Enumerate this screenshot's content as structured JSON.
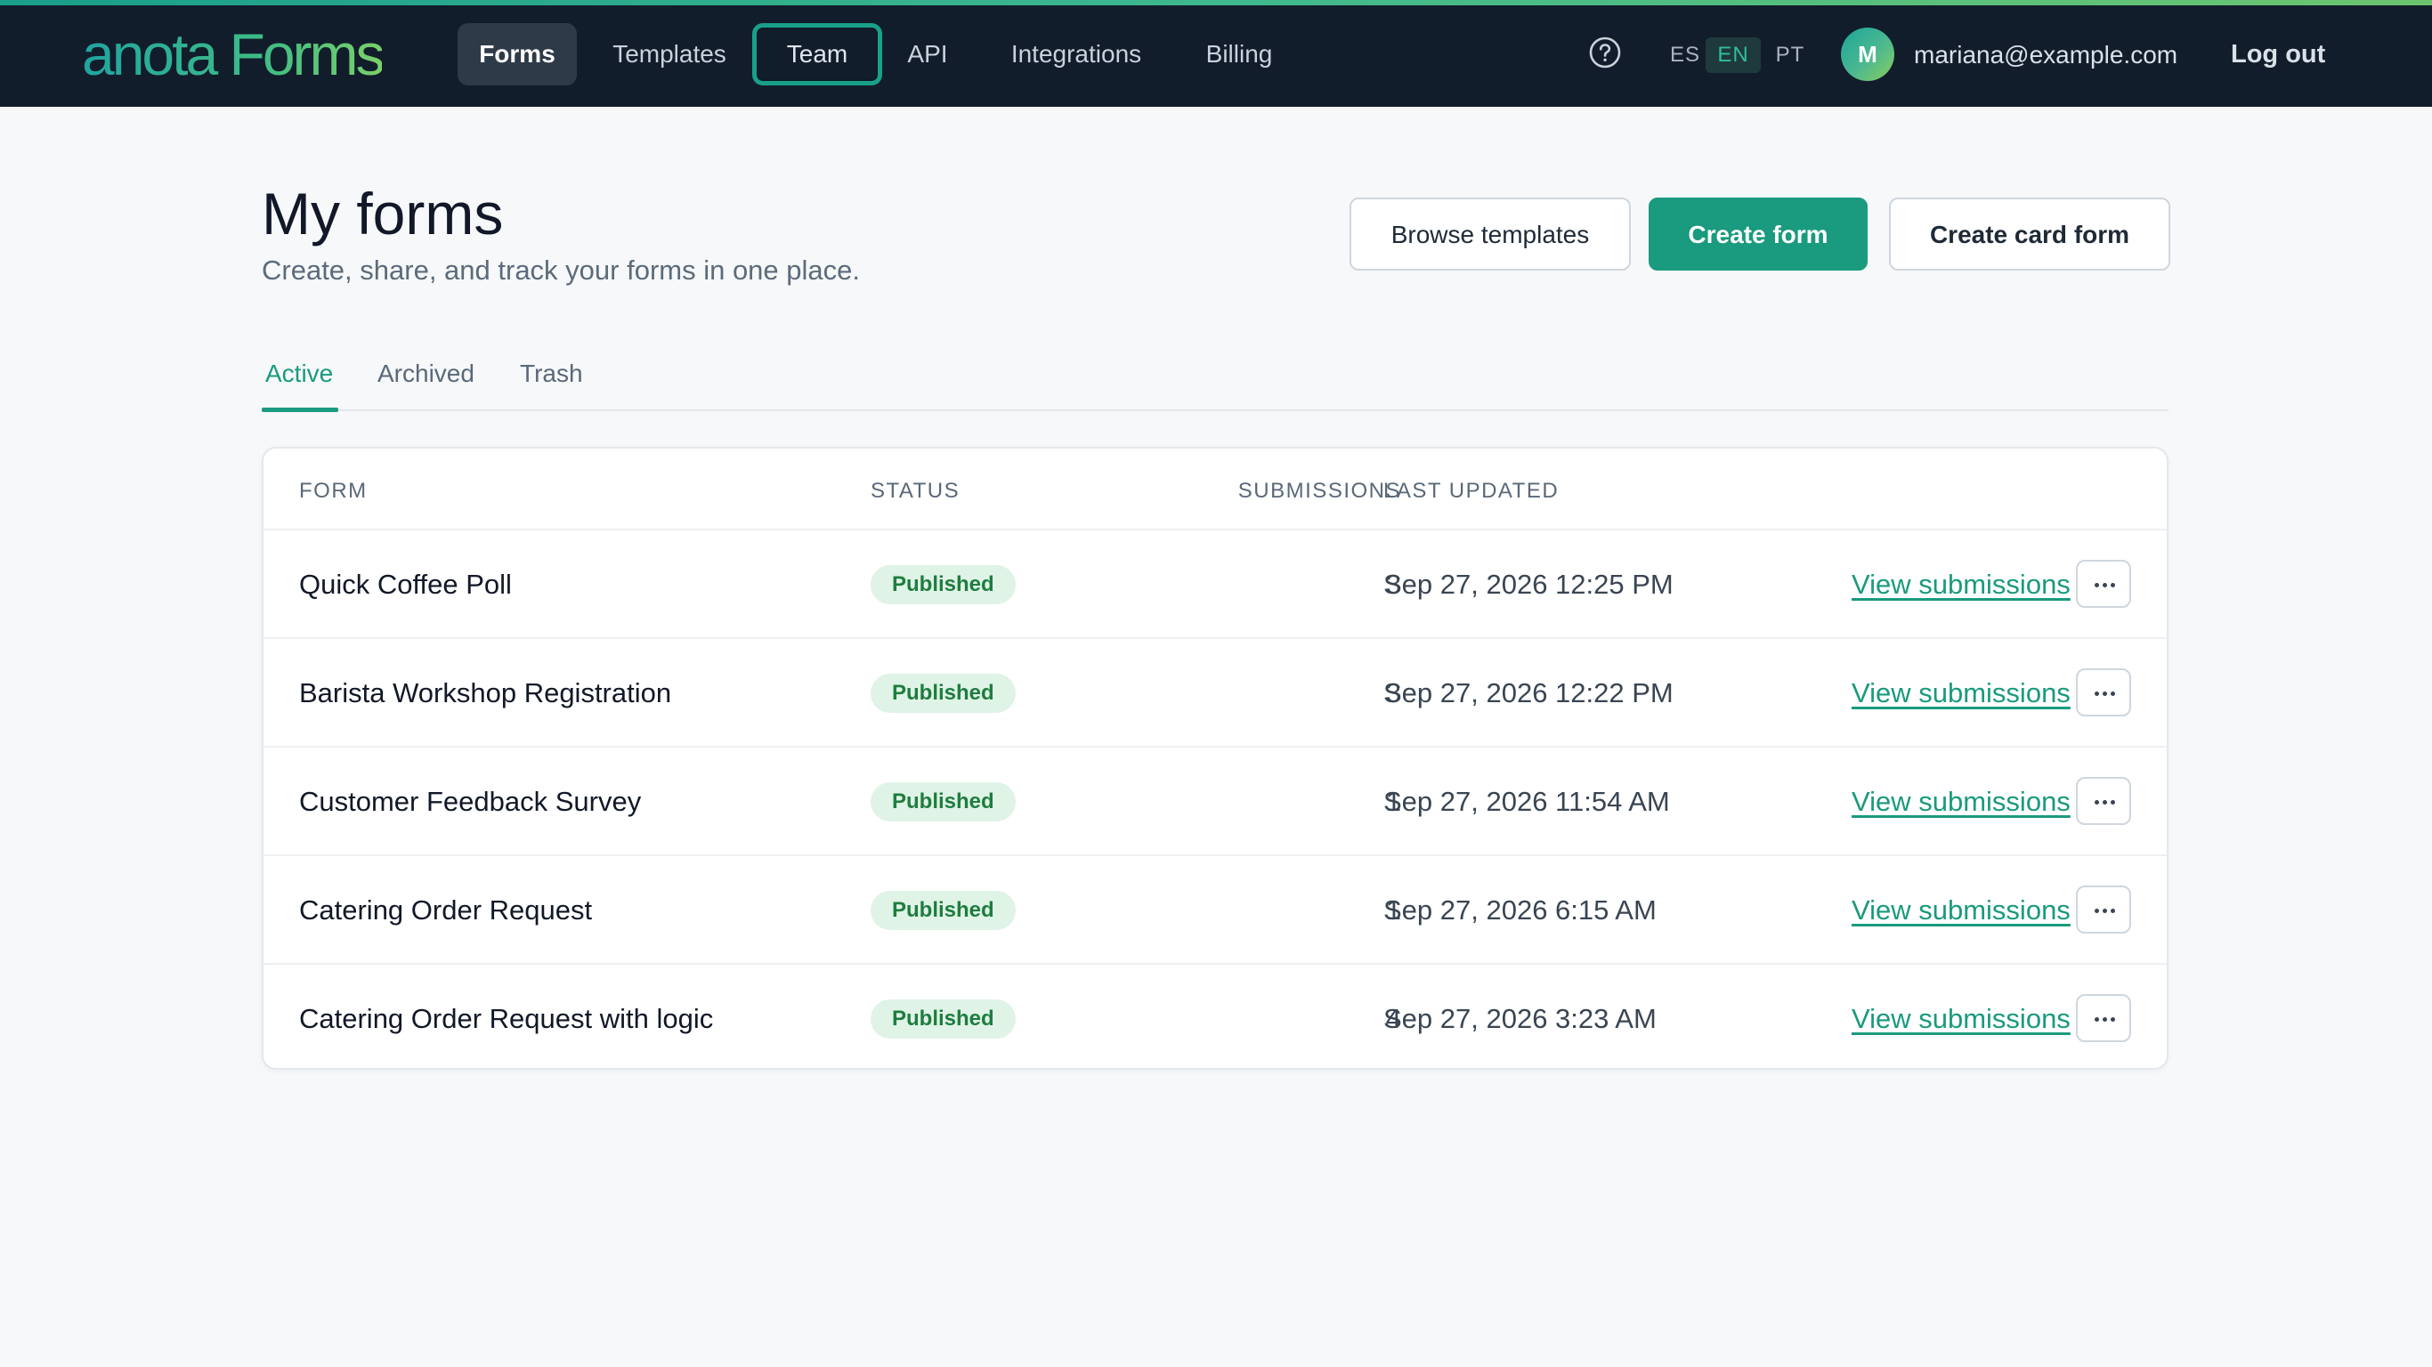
{
  "brand": {
    "logo": "anota Forms"
  },
  "nav": {
    "items": [
      {
        "label": "Forms"
      },
      {
        "label": "Templates"
      },
      {
        "label": "Team"
      },
      {
        "label": "API"
      },
      {
        "label": "Integrations"
      },
      {
        "label": "Billing"
      }
    ],
    "active": "Forms",
    "focused": "Team",
    "languages": [
      "ES",
      "EN",
      "PT"
    ],
    "active_language": "EN",
    "help_icon": "help-circle-icon",
    "user": {
      "avatar_initial": "M",
      "email": "mariana@example.com"
    },
    "logout_label": "Log out"
  },
  "header": {
    "title": "My forms",
    "subtitle": "Create, share, and track your forms in one place.",
    "actions": {
      "browse_templates": "Browse templates",
      "create_form": "Create form",
      "create_card_form": "Create card form"
    }
  },
  "tabs": [
    {
      "label": "Active"
    },
    {
      "label": "Archived"
    },
    {
      "label": "Trash"
    }
  ],
  "active_tab": "Active",
  "table": {
    "columns": {
      "form": "FORM",
      "status": "STATUS",
      "submissions": "SUBMISSIONS",
      "last_updated": "LAST UPDATED"
    },
    "rows": [
      {
        "name": "Quick Coffee Poll",
        "status": "Published",
        "submissions": "3",
        "last_updated": "Sep 27, 2026 12:25 PM",
        "link": "View submissions"
      },
      {
        "name": "Barista Workshop Registration",
        "status": "Published",
        "submissions": "3",
        "last_updated": "Sep 27, 2026 12:22 PM",
        "link": "View submissions"
      },
      {
        "name": "Customer Feedback Survey",
        "status": "Published",
        "submissions": "1",
        "last_updated": "Sep 27, 2026 11:54 AM",
        "link": "View submissions"
      },
      {
        "name": "Catering Order Request",
        "status": "Published",
        "submissions": "1",
        "last_updated": "Sep 27, 2026 6:15 AM",
        "link": "View submissions"
      },
      {
        "name": "Catering Order Request with logic",
        "status": "Published",
        "submissions": "4",
        "last_updated": "Sep 27, 2026 3:23 AM",
        "link": "View submissions"
      }
    ]
  },
  "colors": {
    "topbar": "#121d2b",
    "accent": "#1a9a7e",
    "badge_bg": "#dff3e6",
    "badge_text": "#1e7d3f"
  }
}
